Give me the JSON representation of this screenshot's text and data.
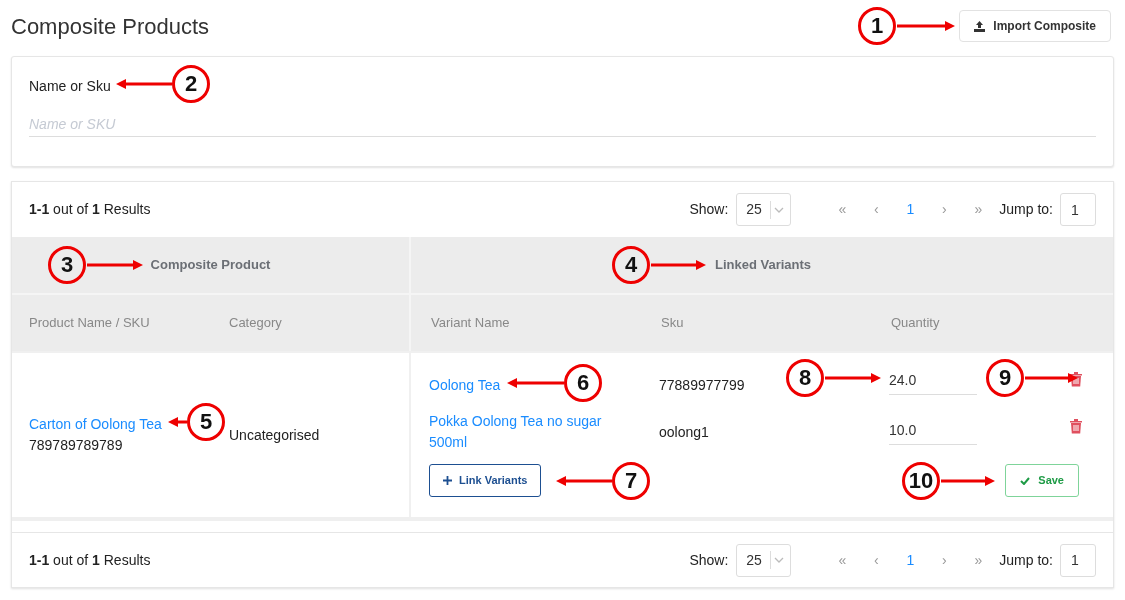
{
  "page": {
    "title": "Composite Products",
    "import_button": "Import Composite"
  },
  "filter": {
    "label": "Name or Sku",
    "placeholder": "Name or SKU"
  },
  "pagination_top": {
    "summary": "**1-1** out of **1** Results",
    "show_label": "Show:",
    "page_size": "25",
    "first": "«",
    "prev": "‹",
    "pages": [
      {
        "label": "1",
        "selected": true
      }
    ],
    "next": "›",
    "last": "»",
    "jump_label": "Jump to:",
    "jump_value": "1"
  },
  "table": {
    "groups": [
      "Composite Product",
      "Linked Variants"
    ],
    "columns": [
      "Product Name / SKU",
      "Category",
      "Variant Name",
      "Sku",
      "Quantity"
    ],
    "rows": [
      {
        "product_name": "Carton of Oolong Tea",
        "product_sku": "789789789789",
        "category": "Uncategorised",
        "variants": [
          {
            "name": "Oolong Tea",
            "sku": "77889977799",
            "quantity": "24.0"
          },
          {
            "name": "Pokka Oolong Tea no sugar 500ml",
            "sku": "oolong1",
            "quantity": "10.0"
          }
        ],
        "link_button": "Link Variants",
        "save_button": "Save"
      }
    ]
  },
  "pagination_bottom": {
    "summary": "**1-1** out of **1** Results",
    "show_label": "Show:",
    "page_size": "25",
    "first": "«",
    "prev": "‹",
    "pages": [
      {
        "label": "1",
        "selected": true
      }
    ],
    "next": "›",
    "last": "»",
    "jump_label": "Jump to:",
    "jump_value": "1"
  },
  "annotations": [
    {
      "number": "1"
    },
    {
      "number": "2"
    },
    {
      "number": "3"
    },
    {
      "number": "4"
    },
    {
      "number": "5"
    },
    {
      "number": "6"
    },
    {
      "number": "7"
    },
    {
      "number": "8"
    },
    {
      "number": "9"
    },
    {
      "number": "10"
    }
  ]
}
